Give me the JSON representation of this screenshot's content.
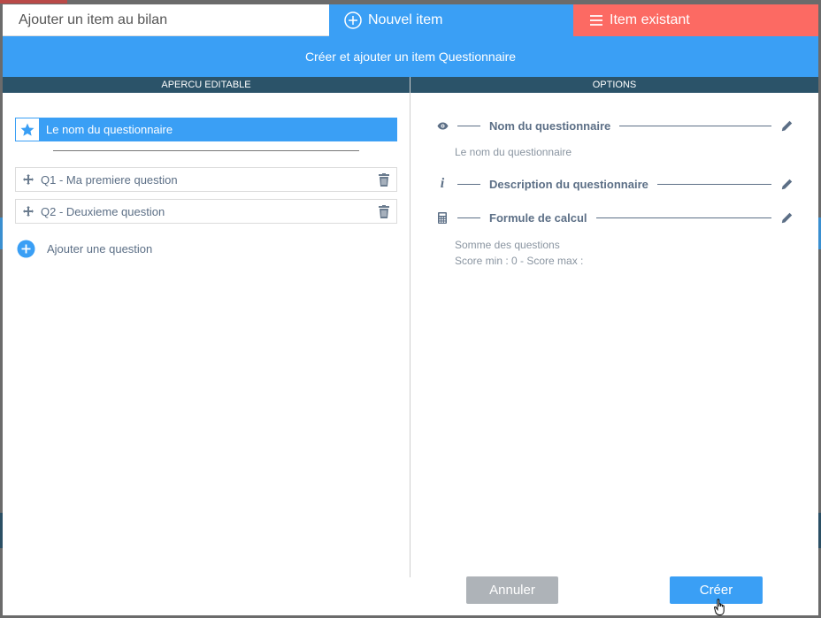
{
  "tabs": {
    "add_item": "Ajouter un item au bilan",
    "new_item": "Nouvel item",
    "existing_item": "Item existant"
  },
  "banner": {
    "title": "Créer et ajouter un item Questionnaire"
  },
  "left_panel": {
    "header": "APERCU EDITABLE",
    "questionnaire_name": "Le nom du questionnaire",
    "questions": [
      {
        "label": "Q1 - Ma premiere question"
      },
      {
        "label": "Q2 - Deuxieme question"
      }
    ],
    "add_question": "Ajouter une question"
  },
  "right_panel": {
    "header": "OPTIONS",
    "name_option": {
      "label": "Nom du questionnaire",
      "value": "Le nom du questionnaire"
    },
    "description_option": {
      "label": "Description du questionnaire"
    },
    "formula_option": {
      "label": "Formule de calcul",
      "value_line1": "Somme des questions",
      "value_line2": "Score min : 0 - Score max :"
    }
  },
  "footer": {
    "cancel_label": "Annuler",
    "create_label": "Créer"
  },
  "colors": {
    "primary": "#3a9ff5",
    "danger": "#fc6a63",
    "header_dark": "#2b5369",
    "text_muted": "#5c6f86",
    "cancel_gray": "#aeb3b8"
  }
}
